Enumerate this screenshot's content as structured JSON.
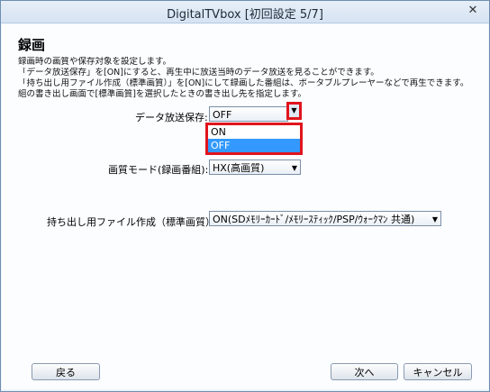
{
  "window": {
    "title": "DigitalTVbox [初回設定 5/7]",
    "close_glyph": "✕"
  },
  "page": {
    "heading": "録画",
    "description": [
      "録画時の画質や保存対象を設定します。",
      "「データ放送保存」を[ON]にすると、再生中に放送当時のデータ放送を見ることができます。",
      "「持ち出し用ファイル作成（標準画質）」を[ON]にして録画した番組は、ポータブルプレーヤーなどで再生できます。ここでは録画番",
      "組の書き出し画面で[標準画質]を選択したときの書き出し先を指定します。"
    ]
  },
  "data_broadcast": {
    "label": "データ放送保存:",
    "value": "OFF",
    "options": [
      "ON",
      "OFF"
    ],
    "selected_index": 1
  },
  "quality": {
    "label": "画質モード(録画番組):",
    "value": "HX(高画質)"
  },
  "portable": {
    "label": "持ち出し用ファイル作成（標準画質）：",
    "value": "ON(SDﾒﾓﾘｰｶｰﾄﾞ/ﾒﾓﾘｰｽﾃｨｯｸ/PSP/ｳｫｰｸﾏﾝ 共通)"
  },
  "buttons": {
    "back": "戻る",
    "next": "次へ",
    "cancel": "キャンセル"
  },
  "icons": {
    "dropdown": "chevron-down-icon",
    "close": "close-icon"
  },
  "colors": {
    "highlight": "#e0141c",
    "selected": "#3399ff"
  }
}
